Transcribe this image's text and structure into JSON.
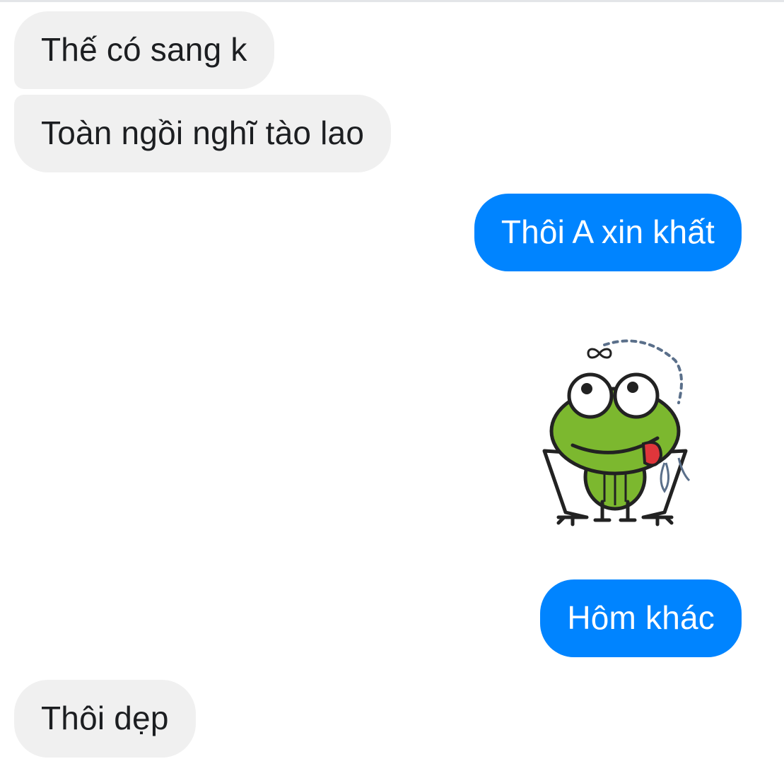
{
  "colors": {
    "incoming_bubble": "#f0f0f0",
    "outgoing_bubble": "#0084ff",
    "incoming_text": "#1c1e21",
    "outgoing_text": "#ffffff",
    "frog_green": "#7cb82f"
  },
  "messages": [
    {
      "sender": "them",
      "text": "Thế có sang k"
    },
    {
      "sender": "them",
      "text": "Toàn ngồi nghĩ tào lao"
    },
    {
      "sender": "me",
      "text": "Thôi A xin khất"
    },
    {
      "sender": "me",
      "sticker": "frog-sticker"
    },
    {
      "sender": "me",
      "text": "Hôm khác"
    },
    {
      "sender": "them",
      "text": "Thôi dẹp"
    }
  ]
}
